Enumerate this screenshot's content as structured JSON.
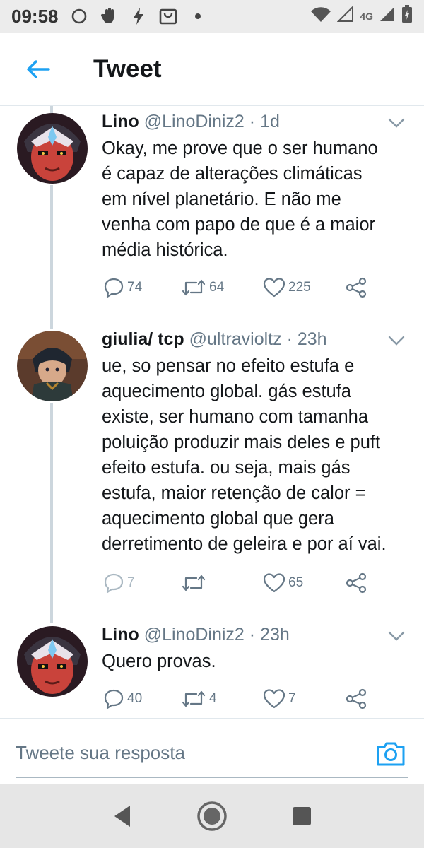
{
  "status_bar": {
    "time": "09:58",
    "network": "4G",
    "icons": [
      "circle-icon",
      "hand-icon",
      "bolt-icon",
      "bag-icon",
      "dot-icon",
      "wifi-icon",
      "signal-icon",
      "battery-icon"
    ]
  },
  "header": {
    "title": "Tweet",
    "back_icon": "arrow-left-icon"
  },
  "tweets": [
    {
      "name": "Lino",
      "handle": "@LinoDiniz2",
      "separator": "·",
      "time": "1d",
      "lines": [
        "Okay, me prove que o ser humano",
        "é capaz de alterações climáticas",
        "em nível planetário. E não me",
        "venha com papo de que é a maior",
        "média histórica."
      ],
      "replies": "74",
      "retweets": "64",
      "likes": "225"
    },
    {
      "name": "giulia/ tcp",
      "handle": "@ultravioltz",
      "separator": "·",
      "time": "23h",
      "lines": [
        "ue, so pensar no efeito estufa e",
        "aquecimento global. gás estufa",
        "existe, ser humano com tamanha",
        "poluição produzir mais deles e puft",
        "efeito estufa. ou seja, mais gás",
        "estufa, maior retenção de calor =",
        "aquecimento global que gera",
        "derretimento de geleira e por aí vai."
      ],
      "replies": "7",
      "retweets": "",
      "likes": "65"
    },
    {
      "name": "Lino",
      "handle": "@LinoDiniz2",
      "separator": "·",
      "time": "23h",
      "lines": [
        "Quero provas."
      ],
      "replies": "40",
      "retweets": "4",
      "likes": "7"
    }
  ],
  "reply_bar": {
    "placeholder": "Tweete sua resposta",
    "camera_icon": "camera-icon"
  },
  "nav_bar": {
    "buttons": [
      "back-triangle-icon",
      "home-circle-icon",
      "recents-square-icon"
    ]
  },
  "colors": {
    "accent": "#1da1f2",
    "text": "#14171a",
    "secondary": "#657786",
    "thread_line": "#ccd6dd"
  }
}
